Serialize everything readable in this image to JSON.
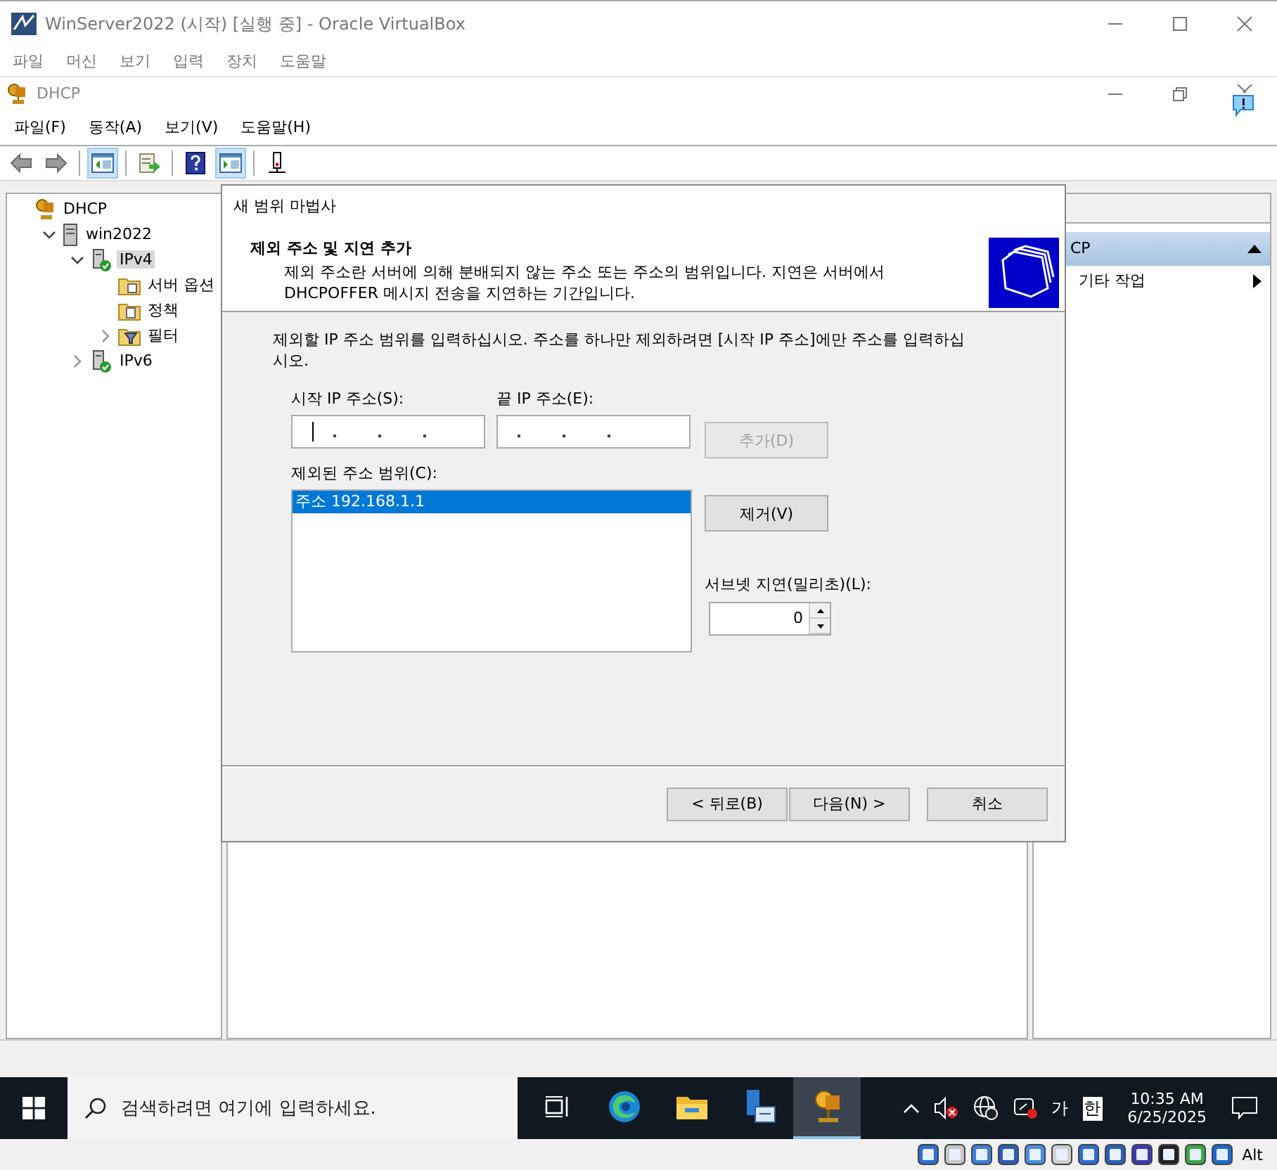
{
  "vbox": {
    "title": "WinServer2022 (시작) [실행 중] - Oracle VirtualBox",
    "menu": [
      "파일",
      "머신",
      "보기",
      "입력",
      "장치",
      "도움말"
    ]
  },
  "mmc": {
    "title": "DHCP",
    "menu": [
      "파일(F)",
      "동작(A)",
      "보기(V)",
      "도움말(H)"
    ],
    "toolbar": [
      {
        "kind": "back",
        "on": false
      },
      {
        "kind": "forward",
        "on": false
      },
      {
        "kind": "tree",
        "on": true
      },
      {
        "kind": "export",
        "on": false
      },
      {
        "kind": "help",
        "on": false
      },
      {
        "kind": "pane",
        "on": true
      },
      {
        "kind": "network",
        "on": false
      }
    ]
  },
  "tree": [
    {
      "label": "DHCP",
      "kind": "dhcp",
      "selected": false,
      "children": [
        {
          "label": "win2022",
          "kind": "server",
          "expanded": true,
          "selected": false,
          "children": [
            {
              "label": "IPv4",
              "kind": "ip",
              "expanded": true,
              "selected": true,
              "children": [
                {
                  "label": "서버 옵션",
                  "kind": "options",
                  "selected": false
                },
                {
                  "label": "정책",
                  "kind": "policy",
                  "selected": false
                },
                {
                  "label": "필터",
                  "kind": "filter",
                  "expanded": false,
                  "selected": false
                }
              ]
            },
            {
              "label": "IPv6",
              "kind": "ip",
              "expanded": false,
              "selected": false
            }
          ]
        }
      ]
    }
  ],
  "actions": {
    "header": "CP",
    "items": [
      "기타 작업"
    ]
  },
  "wizard": {
    "title": "새 범위 마법사",
    "heading": "제외 주소 및 지연 추가",
    "description": "제외 주소란 서버에 의해 분배되지 않는 주소 또는 주소의 범위입니다. 지연은 서버에서 DHCPOFFER 메시지 전송을 지연하는 기간입니다.",
    "instruction": "제외할 IP 주소 범위를 입력하십시오. 주소를 하나만 제외하려면 [시작 IP 주소]에만 주소를 입력하십시오.",
    "start_label": "시작 IP 주소(S):",
    "end_label": "끝 IP 주소(E):",
    "add_button": {
      "label": "추가(D)",
      "disabled": true
    },
    "excluded_label": "제외된 주소 범위(C):",
    "excluded": [
      {
        "text": "주소 192.168.1.1",
        "selected": true
      }
    ],
    "remove_button": {
      "label": "제거(V)",
      "disabled": false
    },
    "delay_label": "서브넷 지연(밀리초)(L):",
    "delay_value": "0",
    "buttons": [
      {
        "label": "< 뒤로(B)",
        "kind": "back"
      },
      {
        "label": "다음(N) >",
        "kind": "next"
      },
      {
        "label": "취소",
        "kind": "cancel"
      }
    ]
  },
  "taskbar": {
    "search_placeholder": "검색하려면 여기에 입력하세요.",
    "apps": [
      {
        "kind": "taskview",
        "active": false
      },
      {
        "kind": "edge",
        "active": false
      },
      {
        "kind": "explorer",
        "active": false
      },
      {
        "kind": "servermanager",
        "active": false
      },
      {
        "kind": "dhcp",
        "active": true
      }
    ],
    "ime_mode": "가",
    "ime_lang": "한",
    "time": "10:35 AM",
    "date": "6/25/2025"
  },
  "vbox_status": {
    "host_key": "Alt"
  }
}
